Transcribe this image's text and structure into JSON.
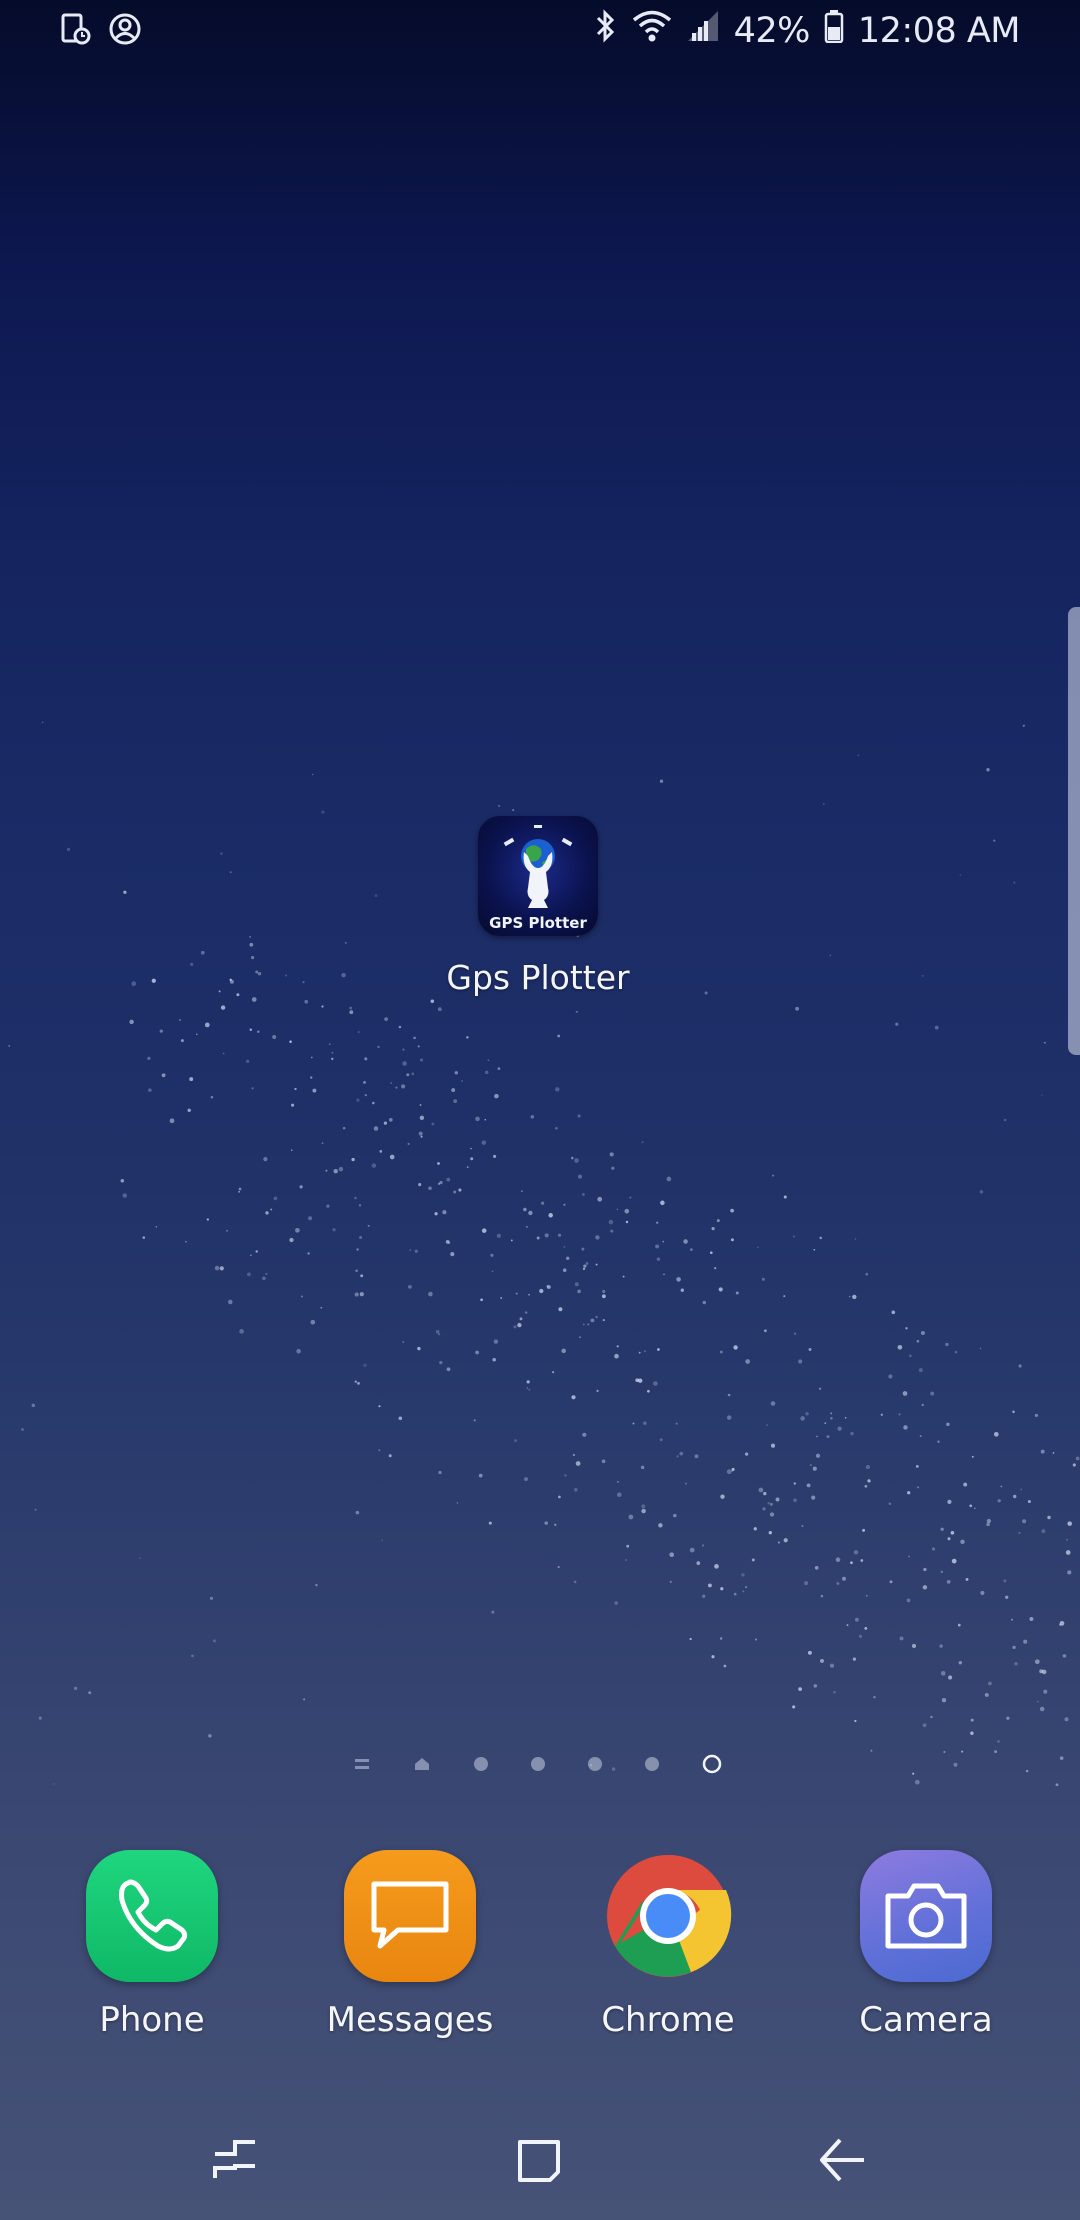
{
  "status_bar": {
    "battery_percent": "42%",
    "time": "12:08 AM",
    "icons": [
      "screen-timer-icon",
      "account-icon",
      "bluetooth-icon",
      "wifi-icon",
      "signal-icon",
      "battery-icon"
    ]
  },
  "home": {
    "shortcut": {
      "label": "Gps Plotter",
      "icon_text": "GPS Plotter",
      "icon": "gps-plotter-icon"
    }
  },
  "page_indicator": {
    "page_count": 6,
    "current_page": 6
  },
  "dock": {
    "items": [
      {
        "label": "Phone",
        "icon": "phone-icon"
      },
      {
        "label": "Messages",
        "icon": "messages-icon"
      },
      {
        "label": "Chrome",
        "icon": "chrome-icon"
      },
      {
        "label": "Camera",
        "icon": "camera-icon"
      }
    ]
  },
  "nav_bar": {
    "buttons": [
      "recents-button",
      "home-button",
      "back-button"
    ]
  },
  "colors": {
    "phone": "#12c46f",
    "messages": "#f0901a",
    "camera": "#6f72dc",
    "wallpaper_top": "#050b2a",
    "wallpaper_bottom": "#465276"
  }
}
